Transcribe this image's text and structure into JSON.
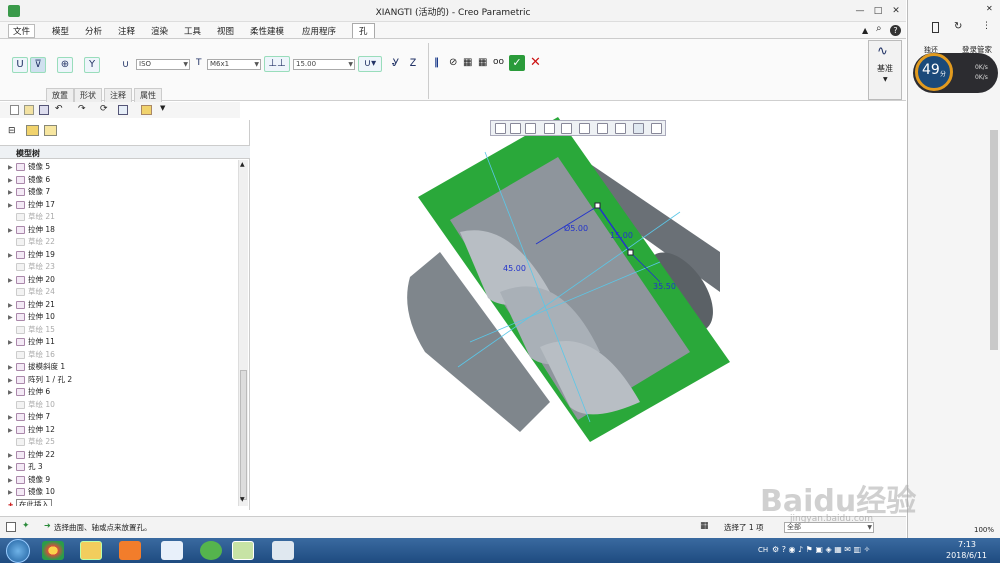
{
  "window": {
    "title": "XIANGTI (活动的) - Creo Parametric",
    "controls": [
      "—",
      "□",
      "✕"
    ],
    "help": [
      "?"
    ]
  },
  "menus": [
    "文件",
    "模型",
    "分析",
    "注释",
    "渲染",
    "工具",
    "视图",
    "柔性建模",
    "应用程序",
    "孔"
  ],
  "ribbon": {
    "standard": "ISO",
    "screw_size": "M6x1",
    "depth_value": "15.00",
    "tabs": [
      "放置",
      "形状",
      "注释",
      "属性"
    ],
    "datum_label": "基准",
    "colors": {
      "ok": "#2a9b3a",
      "cancel": "#cc1111",
      "pause": "#1a3a8a"
    }
  },
  "tree": {
    "header": "模型树",
    "rows": [
      {
        "label": "镜像 5",
        "dim": false,
        "icon": "mirror-icon"
      },
      {
        "label": "镜像 6",
        "dim": false,
        "icon": "mirror-icon"
      },
      {
        "label": "镜像 7",
        "dim": false,
        "icon": "mirror-icon"
      },
      {
        "label": "拉伸 17",
        "dim": false,
        "icon": "extrude-icon"
      },
      {
        "label": "草绘 21",
        "dim": true,
        "icon": "sketch-icon"
      },
      {
        "label": "拉伸 18",
        "dim": false,
        "icon": "extrude-icon"
      },
      {
        "label": "草绘 22",
        "dim": true,
        "icon": "sketch-icon"
      },
      {
        "label": "拉伸 19",
        "dim": false,
        "icon": "extrude-icon"
      },
      {
        "label": "草绘 23",
        "dim": true,
        "icon": "sketch-icon"
      },
      {
        "label": "拉伸 20",
        "dim": false,
        "icon": "extrude-icon"
      },
      {
        "label": "草绘 24",
        "dim": true,
        "icon": "sketch-icon"
      },
      {
        "label": "拉伸 21",
        "dim": false,
        "icon": "extrude-icon"
      },
      {
        "label": "拉伸 10",
        "dim": false,
        "icon": "extrude-icon"
      },
      {
        "label": "草绘 15",
        "dim": true,
        "icon": "sketch-icon"
      },
      {
        "label": "拉伸 11",
        "dim": false,
        "icon": "extrude-icon"
      },
      {
        "label": "草绘 16",
        "dim": true,
        "icon": "sketch-icon"
      },
      {
        "label": "拔模斜度 1",
        "dim": false,
        "icon": "draft-icon"
      },
      {
        "label": "阵列 1 / 孔 2",
        "dim": false,
        "icon": "pattern-icon"
      },
      {
        "label": "拉伸 6",
        "dim": false,
        "icon": "extrude-icon"
      },
      {
        "label": "草绘 10",
        "dim": true,
        "icon": "sketch-icon"
      },
      {
        "label": "拉伸 7",
        "dim": false,
        "icon": "extrude-icon"
      },
      {
        "label": "拉伸 12",
        "dim": false,
        "icon": "extrude-icon"
      },
      {
        "label": "草绘 25",
        "dim": true,
        "icon": "sketch-icon"
      },
      {
        "label": "拉伸 22",
        "dim": false,
        "icon": "extrude-icon"
      },
      {
        "label": "孔 3",
        "dim": false,
        "icon": "hole-icon"
      },
      {
        "label": "镜像 9",
        "dim": false,
        "icon": "mirror-icon"
      },
      {
        "label": "镜像 10",
        "dim": false,
        "icon": "mirror-icon"
      }
    ],
    "insert_here": "在此插入"
  },
  "model": {
    "dims": [
      "45.00",
      "Ø5.00",
      "15.00",
      "35.50"
    ],
    "colors": {
      "plate": "#2aa83a",
      "body": "#8e959c"
    }
  },
  "status": {
    "message": "选择曲面、轴或点来放置孔。",
    "selected": "选择了 1 项",
    "filter": "全部"
  },
  "sidebar": {
    "link1": "独还",
    "login": "登录管家",
    "score": "49",
    "score_unit": "分",
    "up": "0K/s",
    "down": "0K/s",
    "zoom": "100%"
  },
  "taskbar": {
    "lang": "CH",
    "time": "7:13",
    "date": "2018/6/11"
  },
  "watermark": "Baidu经验",
  "watermark_url": "jingyan.baidu.com"
}
